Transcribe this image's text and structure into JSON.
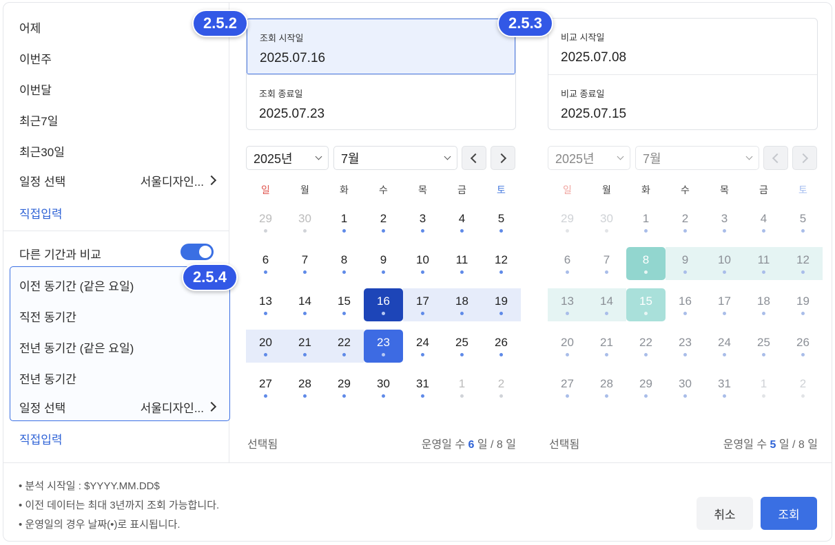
{
  "badges": [
    "2.5.2",
    "2.5.3",
    "2.5.4"
  ],
  "quick_presets": [
    "어제",
    "이번주",
    "이번달",
    "최근7일",
    "최근30일"
  ],
  "schedule_select": {
    "label": "일정 선택",
    "value": "서울디자인..."
  },
  "direct_input": "직접입력",
  "compare": {
    "label": "다른 기간과 비교",
    "toggle_on": true,
    "options": [
      "이전 동기간 (같은 요일)",
      "직전 동기간",
      "전년 동기간 (같은 요일)",
      "전년 동기간"
    ],
    "schedule_select": {
      "label": "일정 선택",
      "value": "서울디자인..."
    },
    "direct_input": "직접입력"
  },
  "main_range": {
    "start_label": "조회 시작일",
    "start_value": "2025.07.16",
    "end_label": "조회 종료일",
    "end_value": "2025.07.23"
  },
  "compare_range": {
    "start_label": "비교 시작일",
    "start_value": "2025.07.08",
    "end_label": "비교 종료일",
    "end_value": "2025.07.15"
  },
  "calendar_main": {
    "year": "2025년",
    "month": "7월",
    "footer_left": "선택됨",
    "footer_count_prefix": "운영일 수",
    "footer_count": "6",
    "footer_count_suffix": "일 / 8 일"
  },
  "calendar_compare": {
    "year": "2025년",
    "month": "7월",
    "footer_left": "선택됨",
    "footer_count_prefix": "운영일 수",
    "footer_count": "5",
    "footer_count_suffix": "일 / 8 일"
  },
  "weekdays": [
    "일",
    "월",
    "화",
    "수",
    "목",
    "금",
    "토"
  ],
  "weekday_colors": {
    "sun": "#e0564f",
    "sat": "#4d7fe0"
  },
  "weeks": [
    [
      29,
      30,
      1,
      2,
      3,
      4,
      5
    ],
    [
      6,
      7,
      8,
      9,
      10,
      11,
      12
    ],
    [
      13,
      14,
      15,
      16,
      17,
      18,
      19
    ],
    [
      20,
      21,
      22,
      23,
      24,
      25,
      26
    ],
    [
      27,
      28,
      29,
      30,
      31,
      1,
      2
    ]
  ],
  "notes": [
    "• 분석 시작일 : $YYYY.MM.DD$",
    "• 이전 데이터는 최대 3년까지 조회 가능합니다.",
    "• 운영일의 경우 날짜(•)로 표시됩니다."
  ],
  "buttons": {
    "cancel": "취소",
    "confirm": "조회"
  },
  "colors": {
    "accent": "#3a6fe3",
    "compare": "#92d6cf",
    "badge": "#3258e6"
  }
}
